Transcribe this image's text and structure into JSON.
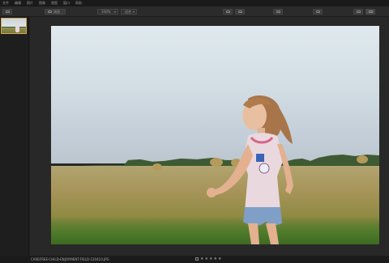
{
  "menubar": {
    "items": [
      "文件",
      "编辑",
      "照片",
      "图像",
      "视图",
      "窗口",
      "帮助"
    ]
  },
  "toolbar": {
    "browse_label": "浏览",
    "view_select": "100%",
    "zoom_select": "适合"
  },
  "filmstrip": {
    "selected_index": 0
  },
  "photo": {
    "subject": "girl running in field"
  },
  "statusbar": {
    "filename": "CAREFREE-CHILD-ENJOYMENT-FIELD-120410.JPG",
    "rating_stars": 5,
    "star_glyph": "★"
  },
  "colors": {
    "accent": "#d9a74a",
    "background": "#232323"
  }
}
